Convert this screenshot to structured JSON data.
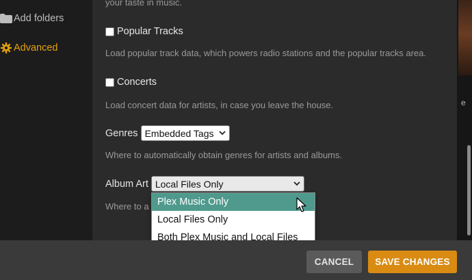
{
  "sidebar": {
    "items": [
      {
        "label": "Add folders",
        "icon": "folder-icon"
      },
      {
        "label": "Advanced",
        "icon": "gear-icon",
        "active": true
      }
    ]
  },
  "settings": {
    "top_desc": "your taste in music.",
    "popular_tracks": {
      "label": "Popular Tracks",
      "checked": false,
      "desc": "Load popular track data, which powers radio stations and the popular tracks area."
    },
    "concerts": {
      "label": "Concerts",
      "checked": false,
      "desc": "Load concert data for artists, in case you leave the house."
    },
    "genres": {
      "label": "Genres",
      "value": "Embedded Tags",
      "desc": "Where to automatically obtain genres for artists and albums."
    },
    "album_art": {
      "label": "Album Art",
      "value": "Local Files Only",
      "desc_visible": "Where to a",
      "options": [
        "Plex Music Only",
        "Local Files Only",
        "Both Plex Music and Local Files"
      ],
      "highlighted_option": "Plex Music Only"
    }
  },
  "right_strip": {
    "letter": "e"
  },
  "footer": {
    "cancel_label": "CANCEL",
    "save_label": "SAVE CHANGES"
  },
  "colors": {
    "accent": "#e5a00d",
    "save_button": "#d98b12",
    "dropdown_highlight": "#4f9a8d"
  }
}
